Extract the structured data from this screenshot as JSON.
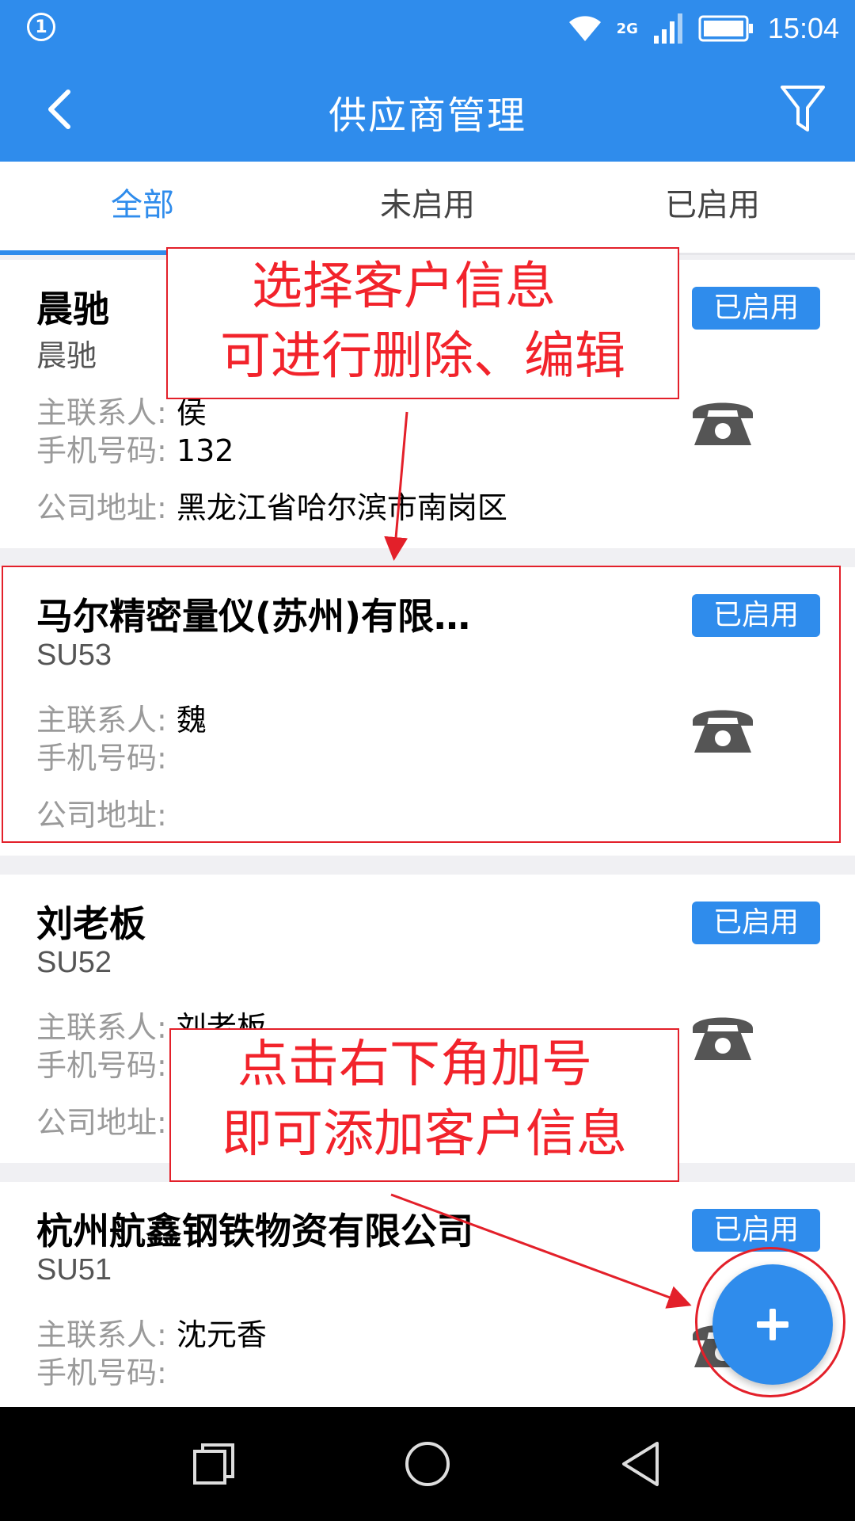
{
  "status_bar": {
    "notification_count": "1",
    "network": "2G",
    "time": "15:04",
    "icons": [
      "wifi-icon",
      "signal-icon",
      "battery-icon"
    ]
  },
  "app_bar": {
    "title": "供应商管理",
    "back_icon": "chevron-left-icon",
    "filter_icon": "filter-icon"
  },
  "tabs": [
    {
      "label": "全部",
      "active": true
    },
    {
      "label": "未启用",
      "active": false
    },
    {
      "label": "已启用",
      "active": false
    }
  ],
  "field_labels": {
    "contact": "主联系人:",
    "mobile": "手机号码:",
    "address": "公司地址:"
  },
  "suppliers": [
    {
      "name": "晨驰",
      "code": "晨驰",
      "status": "已启用",
      "contact": "侯",
      "mobile": "132",
      "address": "黑龙江省哈尔滨市南岗区"
    },
    {
      "name": "马尔精密量仪(苏州)有限…",
      "code": "SU53",
      "status": "已启用",
      "contact": "魏",
      "mobile": "",
      "address": ""
    },
    {
      "name": "刘老板",
      "code": "SU52",
      "status": "已启用",
      "contact": "刘老板",
      "mobile": "",
      "address": ""
    },
    {
      "name": "杭州航鑫钢铁物资有限公司",
      "code": "SU51",
      "status": "已启用",
      "contact": "沈元香",
      "mobile": "",
      "address": ""
    }
  ],
  "annotations": {
    "select_line1": "选择客户信息",
    "select_line2": "可进行删除、编辑",
    "add_line1": "点击右下角加号",
    "add_line2": "即可添加客户信息"
  },
  "fab": {
    "icon": "plus-icon",
    "label": "+"
  },
  "nav_bar": [
    "recent-apps-icon",
    "home-icon",
    "back-triangle-icon"
  ],
  "colors": {
    "primary": "#2f8cec",
    "annotation": "#e3202a",
    "label_gray": "#9a9a9a",
    "phone_icon": "#555555"
  }
}
